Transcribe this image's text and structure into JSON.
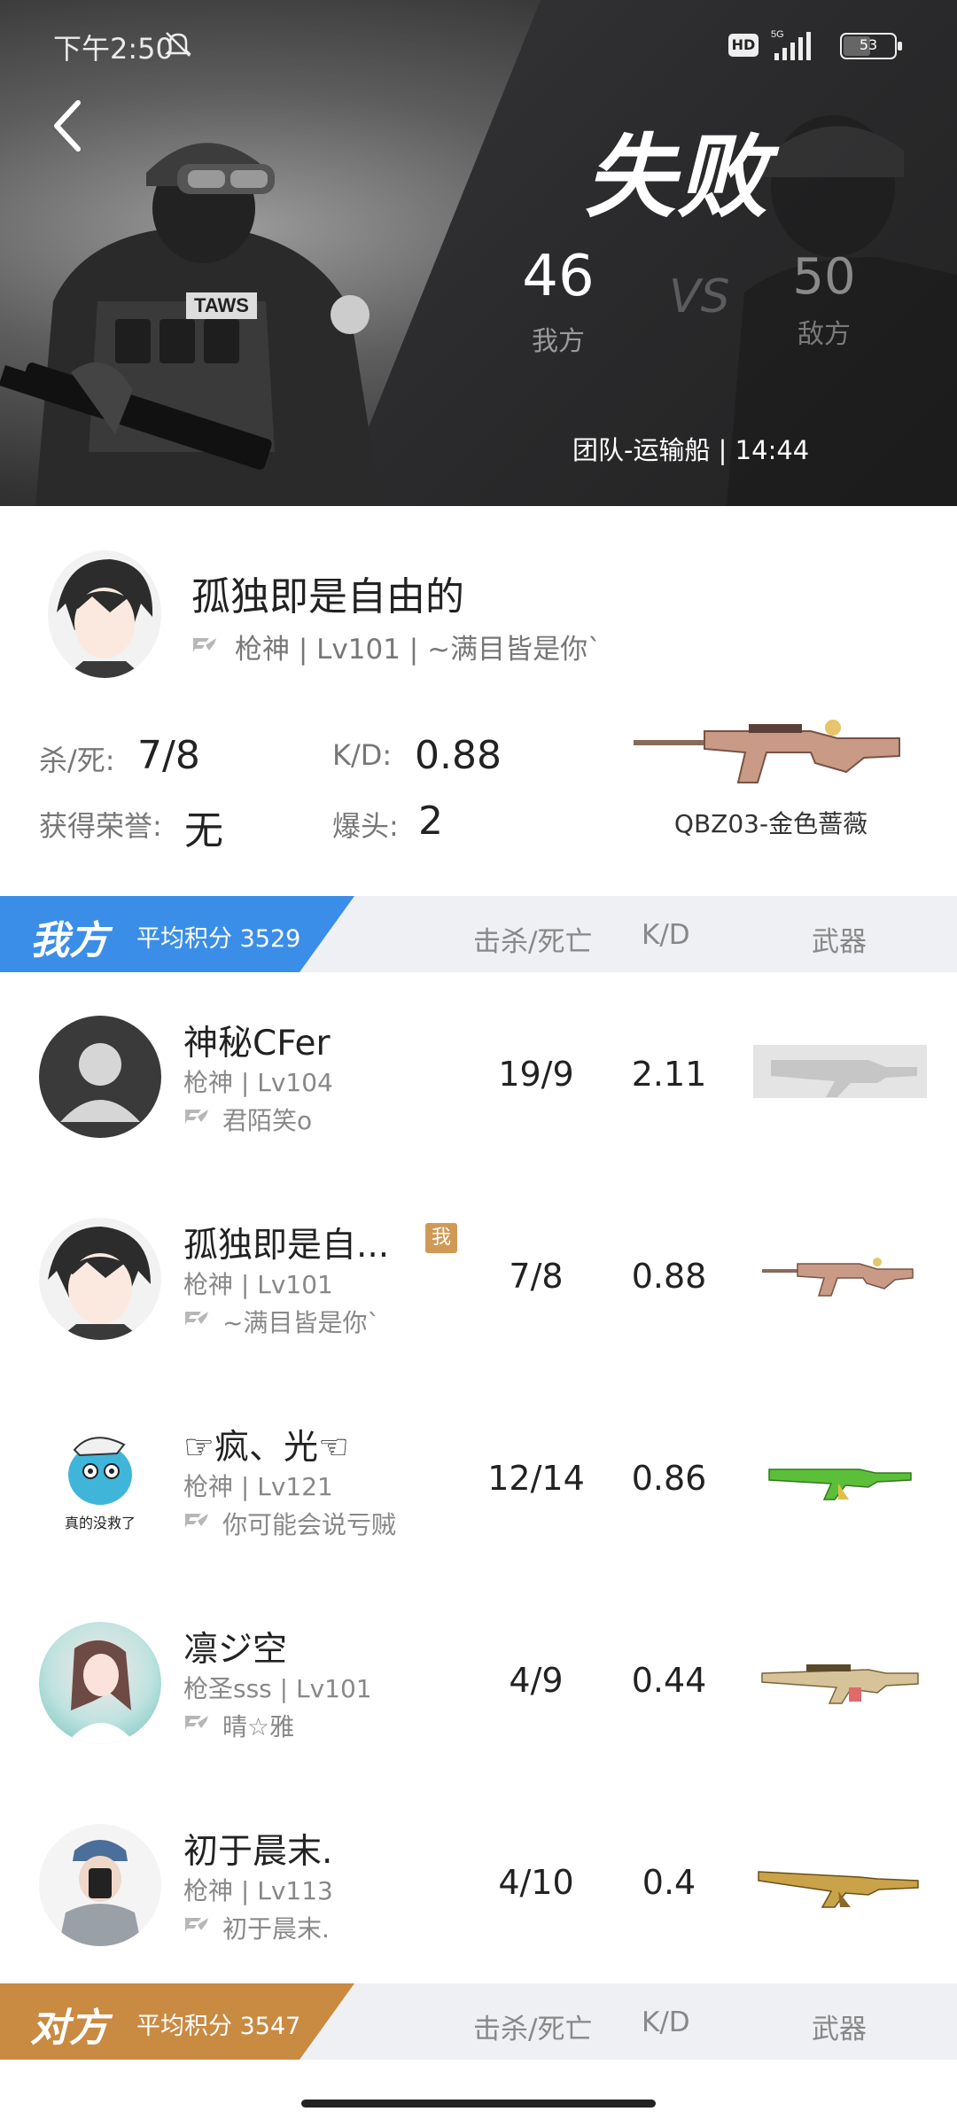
{
  "status_bar": {
    "time": "下午2:50",
    "network": "5G",
    "hd": "HD",
    "battery": "53"
  },
  "banner": {
    "result": "失败",
    "our_score": "46",
    "our_label": "我方",
    "vs": "VS",
    "their_score": "50",
    "their_label": "敌方",
    "match_info": "团队-运输船 | 14:44",
    "soldier_badge": "TAWS"
  },
  "player": {
    "name": "孤独即是自由的",
    "subtitle": "枪神 | Lv101 | ~满目皆是你`",
    "kill_death_label": "杀/死:",
    "kill_death_value": "7/8",
    "kd_label": "K/D:",
    "kd_value": "0.88",
    "honor_label": "获得荣誉:",
    "honor_value": "无",
    "headshot_label": "爆头:",
    "headshot_value": "2",
    "weapon_name": "QBZ03-金色蔷薇"
  },
  "our_team": {
    "name": "我方",
    "avg_score": "平均积分 3529",
    "col_kills": "击杀/死亡",
    "col_kd": "K/D",
    "col_weapon": "武器",
    "color": "#3b8ee8",
    "rows": [
      {
        "name": "神秘CFer",
        "level": "枪神 | Lv104",
        "clan": "君陌笑o",
        "kills_deaths": "19/9",
        "kd": "2.11",
        "weapon": "ak47-default"
      },
      {
        "name": "孤独即是自...",
        "level": "枪神 | Lv101",
        "clan": "~满目皆是你`",
        "kills_deaths": "7/8",
        "kd": "0.88",
        "weapon": "qbz03-gold-rose",
        "me": "我"
      },
      {
        "name": "☞疯、光☜",
        "level": "枪神 | Lv121",
        "clan": "你可能会说亏贼",
        "kills_deaths": "12/14",
        "kd": "0.86",
        "weapon": "ak47-green",
        "avatar_text": "真的没救了"
      },
      {
        "name": "凛ジ空",
        "level": "枪圣sss | Lv101",
        "clan": "晴☆雅",
        "kills_deaths": "4/9",
        "kd": "0.44",
        "weapon": "rifle-gold"
      },
      {
        "name": "初于晨末.",
        "level": "枪神 | Lv113",
        "clan": "初于晨末.",
        "kills_deaths": "4/10",
        "kd": "0.4",
        "weapon": "ak47-gold"
      }
    ]
  },
  "enemy_team": {
    "name": "对方",
    "avg_score": "平均积分 3547",
    "col_kills": "击杀/死亡",
    "col_kd": "K/D",
    "col_weapon": "武器",
    "color": "#c98a42"
  }
}
